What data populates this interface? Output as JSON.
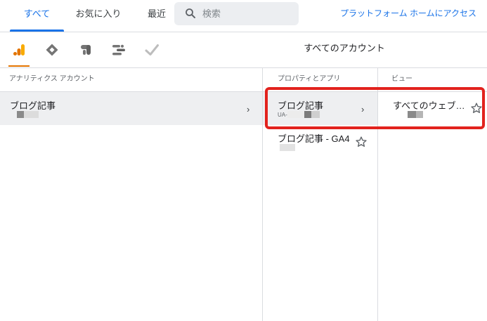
{
  "tabs": {
    "all": "すべて",
    "favorites": "お気に入り",
    "recent": "最近"
  },
  "search": {
    "placeholder": "検索",
    "value": ""
  },
  "platform_link": "プラットフォーム ホームにアクセス",
  "products": {
    "title": "すべてのアカウント",
    "icons": [
      "analytics-icon",
      "tag-manager-icon",
      "optimize-icon",
      "data-studio-icon",
      "surveys-icon"
    ],
    "active_color": "#e37400"
  },
  "columns": {
    "account": {
      "header": "アナリティクス アカウント",
      "rows": [
        {
          "name": "ブログ記事"
        }
      ]
    },
    "property": {
      "header": "プロパティとアプリ",
      "rows": [
        {
          "name": "ブログ記事",
          "id": "UA-"
        },
        {
          "name": "ブログ記事 - GA4"
        }
      ]
    },
    "view": {
      "header": "ビュー",
      "rows": [
        {
          "name": "すべてのウェブ…"
        }
      ]
    }
  },
  "colors": {
    "accent": "#1a73e8",
    "highlight": "#e2221d",
    "selected_row": "#eeeff1"
  }
}
